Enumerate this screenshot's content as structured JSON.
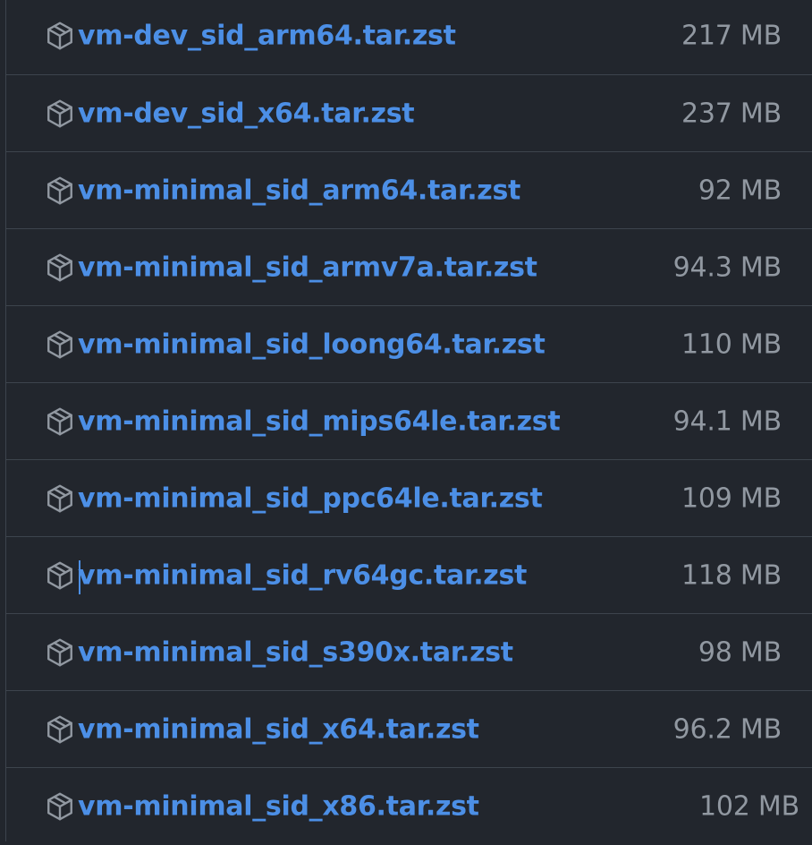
{
  "assets": [
    {
      "name": "vm-dev_sid_arm64.tar.zst",
      "size": "217 MB"
    },
    {
      "name": "vm-dev_sid_x64.tar.zst",
      "size": "237 MB"
    },
    {
      "name": "vm-minimal_sid_arm64.tar.zst",
      "size": "92 MB"
    },
    {
      "name": "vm-minimal_sid_armv7a.tar.zst",
      "size": "94.3 MB"
    },
    {
      "name": "vm-minimal_sid_loong64.tar.zst",
      "size": "110 MB"
    },
    {
      "name": "vm-minimal_sid_mips64le.tar.zst",
      "size": "94.1 MB"
    },
    {
      "name": "vm-minimal_sid_ppc64le.tar.zst",
      "size": "109 MB"
    },
    {
      "name": "vm-minimal_sid_rv64gc.tar.zst",
      "size": "118 MB"
    },
    {
      "name": "vm-minimal_sid_s390x.tar.zst",
      "size": "98 MB"
    },
    {
      "name": "vm-minimal_sid_x64.tar.zst",
      "size": "96.2 MB"
    },
    {
      "name": "vm-minimal_sid_x86.tar.zst",
      "size": "102 MB"
    }
  ],
  "icon": "package-icon",
  "colors": {
    "background": "#22262d",
    "link": "#4c8fe6",
    "size_text": "#9198a1",
    "divider": "#3d444d",
    "icon": "#9198a1"
  },
  "caret_row": 7
}
